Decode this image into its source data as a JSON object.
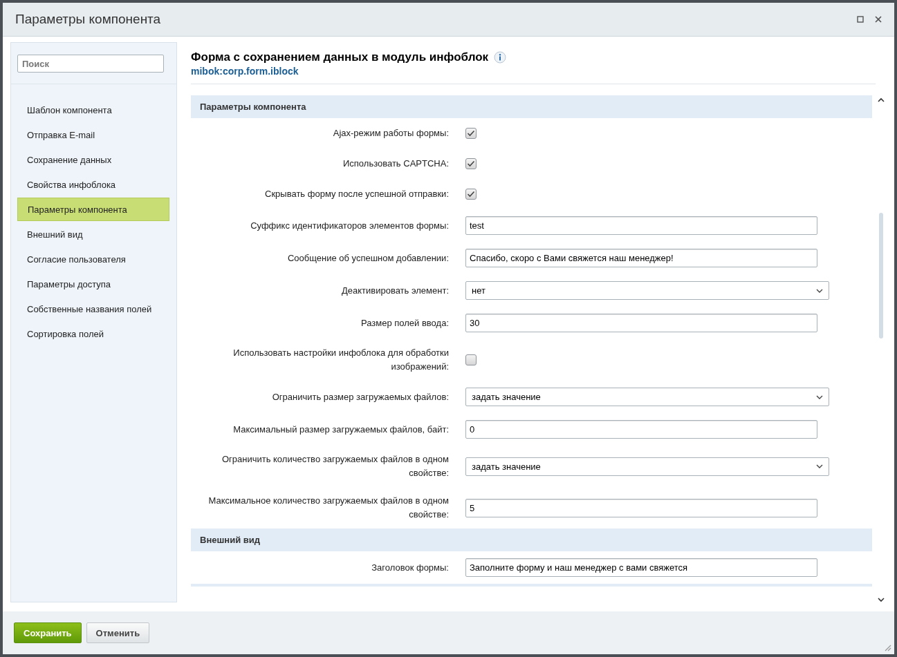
{
  "dialog": {
    "title": "Параметры компонента"
  },
  "search": {
    "placeholder": "Поиск"
  },
  "sidebar": {
    "items": [
      {
        "label": "Шаблон компонента",
        "selected": false
      },
      {
        "label": "Отправка E-mail",
        "selected": false
      },
      {
        "label": "Сохранение данных",
        "selected": false
      },
      {
        "label": "Свойства инфоблока",
        "selected": false
      },
      {
        "label": "Параметры компонента",
        "selected": true
      },
      {
        "label": "Внешний вид",
        "selected": false
      },
      {
        "label": "Согласие пользователя",
        "selected": false
      },
      {
        "label": "Параметры доступа",
        "selected": false
      },
      {
        "label": "Собственные названия полей",
        "selected": false
      },
      {
        "label": "Сортировка полей",
        "selected": false
      }
    ]
  },
  "component": {
    "title": "Форма с сохранением данных в модуль инфоблок",
    "code": "mibok:corp.form.iblock"
  },
  "sections": [
    {
      "title": "Параметры компонента",
      "fields": [
        {
          "kind": "checkbox",
          "label": "Ajax-режим работы формы:",
          "checked": true
        },
        {
          "kind": "checkbox",
          "label": "Использовать CAPTCHA:",
          "checked": true
        },
        {
          "kind": "checkbox",
          "label": "Скрывать форму после успешной отправки:",
          "checked": true
        },
        {
          "kind": "text",
          "label": "Суффикс идентификаторов элементов формы:",
          "value": "test"
        },
        {
          "kind": "text",
          "label": "Сообщение об успешном добавлении:",
          "value": "Спасибо, скоро с Вами свяжется наш менеджер!"
        },
        {
          "kind": "select",
          "label": "Деактивировать элемент:",
          "value": "нет"
        },
        {
          "kind": "text",
          "label": "Размер полей ввода:",
          "value": "30"
        },
        {
          "kind": "checkbox",
          "label": "Использовать настройки инфоблока для обработки изображений:",
          "checked": false
        },
        {
          "kind": "select",
          "label": "Ограничить размер загружаемых файлов:",
          "value": "задать значение"
        },
        {
          "kind": "text",
          "label": "Максимальный размер загружаемых файлов, байт:",
          "value": "0"
        },
        {
          "kind": "select",
          "label": "Ограничить количество загружаемых файлов в одном свойстве:",
          "value": "задать значение"
        },
        {
          "kind": "text",
          "label": "Максимальное количество загружаемых файлов в одном свойстве:",
          "value": "5"
        }
      ]
    },
    {
      "title": "Внешний вид",
      "fields": [
        {
          "kind": "text",
          "label": "Заголовок формы:",
          "value": "Заполните форму и наш менеджер с вами свяжется"
        }
      ]
    }
  ],
  "buttons": [
    {
      "label": "Сохранить",
      "kind": "primary"
    },
    {
      "label": "Отменить",
      "kind": "secondary"
    }
  ]
}
